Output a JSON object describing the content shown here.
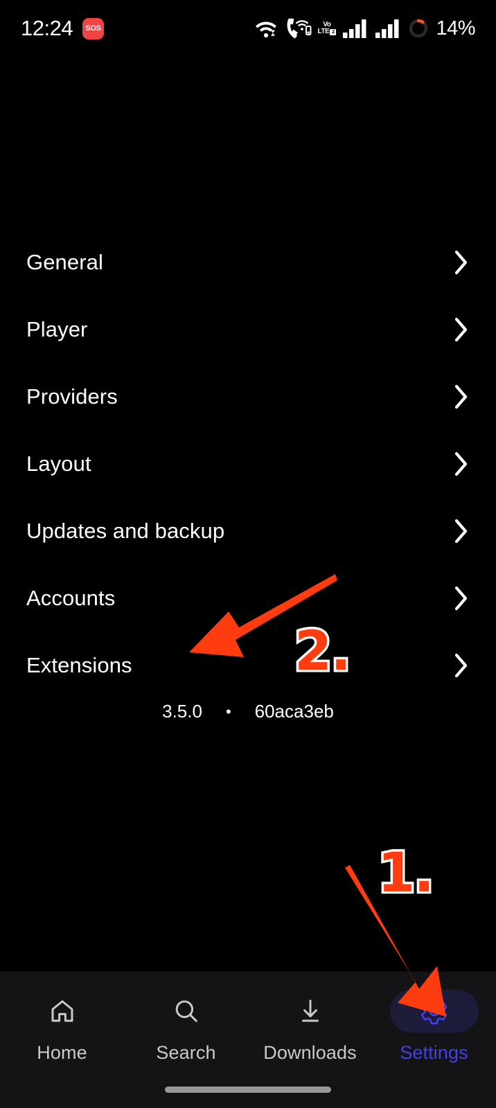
{
  "status_bar": {
    "time": "12:24",
    "sos_label": "SOS",
    "battery_percent": "14%",
    "volte_top": "Vo",
    "volte_bottom": "LTE",
    "volte_sim": "2",
    "icons": [
      "wifi-icon",
      "call-wifi-icon",
      "volte-icon",
      "signal-bars-sim1-icon",
      "signal-bars-sim2-icon",
      "battery-ring-icon"
    ]
  },
  "settings": {
    "items": [
      {
        "label": "General"
      },
      {
        "label": "Player"
      },
      {
        "label": "Providers"
      },
      {
        "label": "Layout"
      },
      {
        "label": "Updates and backup"
      },
      {
        "label": "Accounts"
      },
      {
        "label": "Extensions"
      }
    ],
    "version": {
      "number": "3.5.0",
      "separator": "•",
      "build": "60aca3eb"
    }
  },
  "bottom_nav": {
    "items": [
      {
        "label": "Home",
        "icon": "home-icon",
        "active": false
      },
      {
        "label": "Search",
        "icon": "search-icon",
        "active": false
      },
      {
        "label": "Downloads",
        "icon": "download-icon",
        "active": false
      },
      {
        "label": "Settings",
        "icon": "gear-icon",
        "active": true
      }
    ],
    "active_color": "#4240e8",
    "inactive_color": "#c9cace",
    "active_pill_color": "#1d1d3b",
    "background": "#141416"
  },
  "annotations": {
    "step_1": "1.",
    "step_2": "2.",
    "arrow_color": "#ff3b10",
    "badge_outline_color": "#ffffff",
    "arrow_1_target": "settings-tab",
    "arrow_2_target": "extensions-row"
  },
  "colors": {
    "background": "#000000",
    "text_primary": "#ffffff",
    "accent": "#4240e8",
    "alert": "#ef4444"
  }
}
